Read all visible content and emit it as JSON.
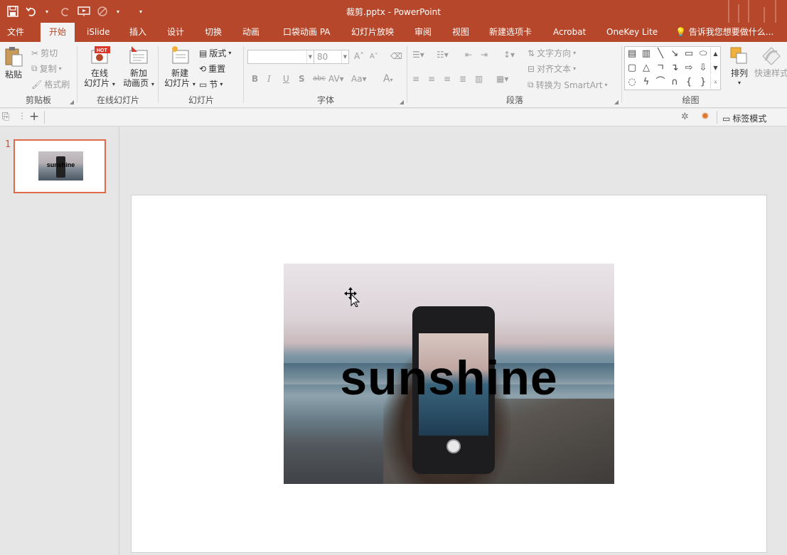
{
  "window": {
    "title": "裁剪.pptx - PowerPoint"
  },
  "tabs": [
    {
      "label": "文件",
      "active": false
    },
    {
      "label": "开始",
      "active": true
    },
    {
      "label": "iSlide",
      "active": false
    },
    {
      "label": "插入",
      "active": false
    },
    {
      "label": "设计",
      "active": false
    },
    {
      "label": "切换",
      "active": false
    },
    {
      "label": "动画",
      "active": false
    },
    {
      "label": "口袋动画 PA",
      "active": false
    },
    {
      "label": "幻灯片放映",
      "active": false
    },
    {
      "label": "审阅",
      "active": false
    },
    {
      "label": "视图",
      "active": false
    },
    {
      "label": "新建选项卡",
      "active": false
    },
    {
      "label": "Acrobat",
      "active": false
    },
    {
      "label": "OneKey Lite",
      "active": false
    }
  ],
  "tell_me": "告诉我您想要做什么...",
  "clipboard": {
    "label": "剪贴板",
    "paste": "粘贴",
    "cut": "剪切",
    "copy": "复制",
    "format_painter": "格式刷"
  },
  "online_slides": {
    "label": "在线幻灯片",
    "online_slide_line1": "在线",
    "online_slide_line2": "幻灯片",
    "new_anim_line1": "新加",
    "new_anim_line2": "动画页",
    "hot_badge": "HOT"
  },
  "slides_group": {
    "label": "幻灯片",
    "new_slide_line1": "新建",
    "new_slide_line2": "幻灯片",
    "layout": "版式",
    "reset": "重置",
    "section": "节"
  },
  "font_group": {
    "label": "字体",
    "font_name": "",
    "font_size": "80",
    "bold": "B",
    "italic": "I",
    "underline": "U",
    "shadow": "S",
    "strike": "abc",
    "spacing": "AV",
    "case": "Aa",
    "grow": "A",
    "shrink": "A",
    "color": "A"
  },
  "paragraph_group": {
    "label": "段落",
    "text_direction": "文字方向",
    "align_text": "对齐文本",
    "convert_smartart": "转换为 SmartArt"
  },
  "drawing_group": {
    "label": "绘图",
    "arrange": "排列",
    "quick_styles": "快速样式"
  },
  "subbar": {
    "tag_mode": "标签模式"
  },
  "slide_panel": {
    "number": "1",
    "thumb_text": "sunshine"
  },
  "slide": {
    "text": "sunshine"
  },
  "colors": {
    "accent": "#b7472a",
    "selection": "#e0694a"
  }
}
